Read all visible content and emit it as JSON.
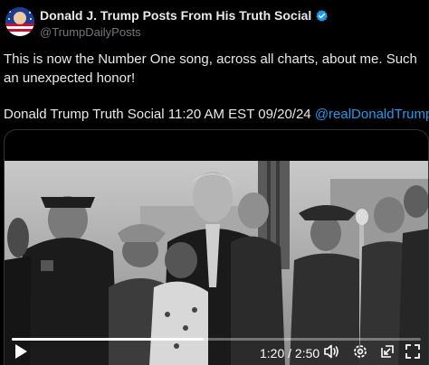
{
  "author": {
    "display_name": "Donald J. Trump Posts From His Truth Social",
    "handle": "@TrumpDailyPosts",
    "verified": true,
    "verified_color": "#1d9bf0"
  },
  "post": {
    "text": "This is now the Number One song, across all charts, about me. Such an unexpected honor!",
    "attribution": "Donald Trump Truth Social 11:20 AM EST 09/20/24",
    "mention": "@realDonaldTrump",
    "mention_color": "#1d9bf0"
  },
  "video": {
    "current_time": "1:20",
    "separator": " / ",
    "duration": "2:50",
    "progress": 0.47,
    "icons": [
      "play-icon",
      "volume-icon",
      "settings-icon",
      "pip-icon",
      "fullscreen-icon"
    ]
  }
}
